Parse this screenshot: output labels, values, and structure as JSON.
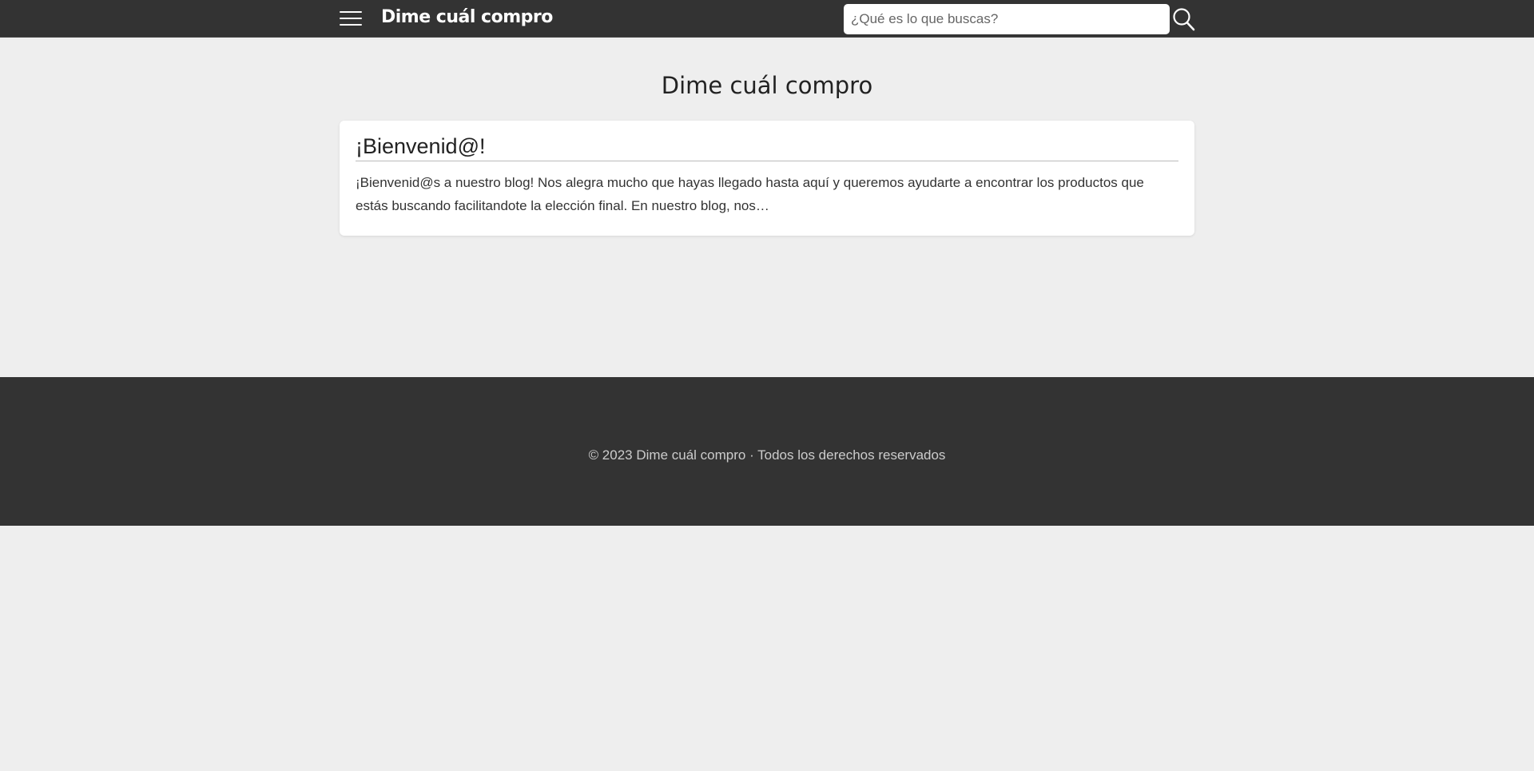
{
  "header": {
    "brand": "Dime cuál compro",
    "search_placeholder": "¿Qué es lo que buscas?",
    "search_value": "",
    "menu_icon": "hamburger-menu-icon",
    "search_icon": "search-icon"
  },
  "main": {
    "title": "Dime cuál compro",
    "posts": [
      {
        "title": "¡Bienvenid@!",
        "excerpt": "¡Bienvenid@s a nuestro blog! Nos alegra mucho que hayas llegado hasta aquí y queremos ayudarte a encontrar los productos que estás buscando facilitandote la elección final. En nuestro blog, nos…"
      }
    ]
  },
  "footer": {
    "text": "© 2023 Dime cuál compro · Todos los derechos reservados"
  },
  "colors": {
    "header_bg": "#333333",
    "page_bg": "#eeeeee",
    "card_bg": "#ffffff",
    "footer_bg": "#333333",
    "footer_text": "#cccccc"
  }
}
